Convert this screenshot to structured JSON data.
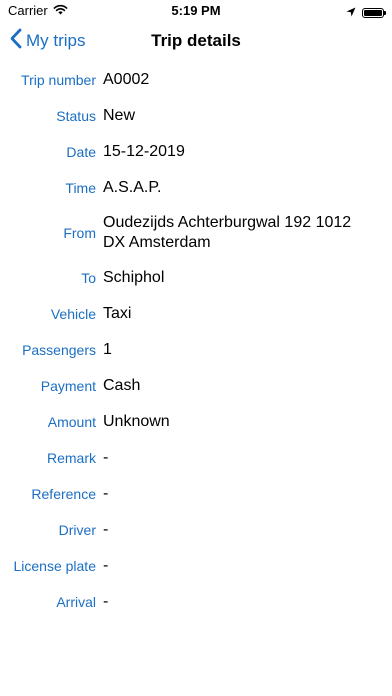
{
  "status_bar": {
    "carrier": "Carrier",
    "time": "5:19 PM",
    "battery_level": 1.0
  },
  "nav": {
    "back_label": "My trips",
    "title": "Trip details",
    "accent_color": "#1b6fc3"
  },
  "details": [
    {
      "label": "Trip number",
      "value": "A0002"
    },
    {
      "label": "Status",
      "value": "New"
    },
    {
      "label": "Date",
      "value": "15-12-2019"
    },
    {
      "label": "Time",
      "value": "A.S.A.P."
    },
    {
      "label": "From",
      "value": "Oudezijds Achterburgwal 192 1012 DX Amsterdam"
    },
    {
      "label": "To",
      "value": "Schiphol"
    },
    {
      "label": "Vehicle",
      "value": "Taxi"
    },
    {
      "label": "Passengers",
      "value": "1"
    },
    {
      "label": "Payment",
      "value": "Cash"
    },
    {
      "label": "Amount",
      "value": "Unknown"
    },
    {
      "label": "Remark",
      "value": "-"
    },
    {
      "label": "Reference",
      "value": "-"
    },
    {
      "label": "Driver",
      "value": "-"
    },
    {
      "label": "License plate",
      "value": "-"
    },
    {
      "label": "Arrival",
      "value": "-"
    }
  ]
}
